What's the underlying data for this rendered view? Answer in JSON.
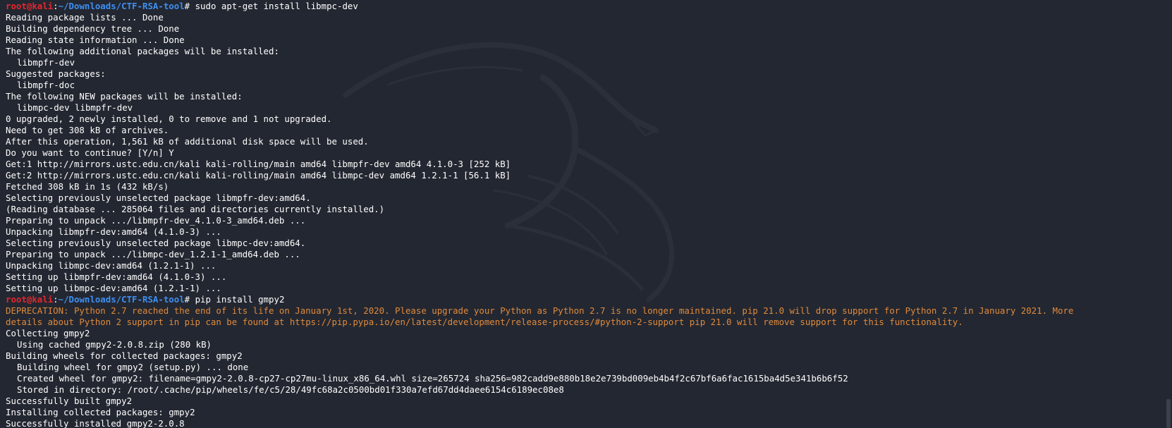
{
  "prompt": {
    "user": "root",
    "at": "@",
    "host": "kali",
    "sep": ":",
    "path": "~/Downloads/CTF-RSA-tool",
    "symbol": "# "
  },
  "command1": "sudo apt-get install libmpc-dev",
  "output1": [
    {
      "text": "Reading package lists ... Done"
    },
    {
      "text": "Building dependency tree ... Done"
    },
    {
      "text": "Reading state information ... Done"
    },
    {
      "text": "The following additional packages will be installed:"
    },
    {
      "text": "libmpfr-dev",
      "indent": true
    },
    {
      "text": "Suggested packages:"
    },
    {
      "text": "libmpfr-doc",
      "indent": true
    },
    {
      "text": "The following NEW packages will be installed:"
    },
    {
      "text": "libmpc-dev libmpfr-dev",
      "indent": true
    },
    {
      "text": "0 upgraded, 2 newly installed, 0 to remove and 1 not upgraded."
    },
    {
      "text": "Need to get 308 kB of archives."
    },
    {
      "text": "After this operation, 1,561 kB of additional disk space will be used."
    },
    {
      "text": "Do you want to continue? [Y/n] Y"
    },
    {
      "text": "Get:1 http://mirrors.ustc.edu.cn/kali kali-rolling/main amd64 libmpfr-dev amd64 4.1.0-3 [252 kB]"
    },
    {
      "text": "Get:2 http://mirrors.ustc.edu.cn/kali kali-rolling/main amd64 libmpc-dev amd64 1.2.1-1 [56.1 kB]"
    },
    {
      "text": "Fetched 308 kB in 1s (432 kB/s)"
    },
    {
      "text": "Selecting previously unselected package libmpfr-dev:amd64."
    },
    {
      "text": "(Reading database ... 285064 files and directories currently installed.)"
    },
    {
      "text": "Preparing to unpack .../libmpfr-dev_4.1.0-3_amd64.deb ..."
    },
    {
      "text": "Unpacking libmpfr-dev:amd64 (4.1.0-3) ..."
    },
    {
      "text": "Selecting previously unselected package libmpc-dev:amd64."
    },
    {
      "text": "Preparing to unpack .../libmpc-dev_1.2.1-1_amd64.deb ..."
    },
    {
      "text": "Unpacking libmpc-dev:amd64 (1.2.1-1) ..."
    },
    {
      "text": "Setting up libmpfr-dev:amd64 (4.1.0-3) ..."
    },
    {
      "text": "Setting up libmpc-dev:amd64 (1.2.1-1) ..."
    }
  ],
  "command2": "pip install gmpy2",
  "deprecation": [
    "DEPRECATION: Python 2.7 reached the end of its life on January 1st, 2020. Please upgrade your Python as Python 2.7 is no longer maintained. pip 21.0 will drop support for Python 2.7 in January 2021. More",
    "details about Python 2 support in pip can be found at https://pip.pypa.io/en/latest/development/release-process/#python-2-support pip 21.0 will remove support for this functionality."
  ],
  "output2": [
    {
      "text": "Collecting gmpy2"
    },
    {
      "text": "Using cached gmpy2-2.0.8.zip (280 kB)",
      "indent": true
    },
    {
      "text": "Building wheels for collected packages: gmpy2"
    },
    {
      "text": "Building wheel for gmpy2 (setup.py) ... done",
      "indent": true
    },
    {
      "text": "Created wheel for gmpy2: filename=gmpy2-2.0.8-cp27-cp27mu-linux_x86_64.whl size=265724 sha256=982cadd9e880b18e2e739bd009eb4b4f2c67bf6a6fac1615ba4d5e341b6b6f52",
      "indent": true
    },
    {
      "text": "Stored in directory: /root/.cache/pip/wheels/fe/c5/28/49fc68a2c0500bd01f330a7efd67dd4daee6154c6189ec08e8",
      "indent": true
    },
    {
      "text": "Successfully built gmpy2"
    },
    {
      "text": "Installing collected packages: gmpy2"
    },
    {
      "text": "Successfully installed gmpy2-2.0.8"
    }
  ],
  "colors": {
    "background": "#232731",
    "prompt_user": "#e8262d",
    "prompt_path": "#3e8ff2",
    "text": "#ffffff",
    "warning": "#e08a3c"
  },
  "icons": {
    "wallpaper": "kali-dragon-icon"
  }
}
